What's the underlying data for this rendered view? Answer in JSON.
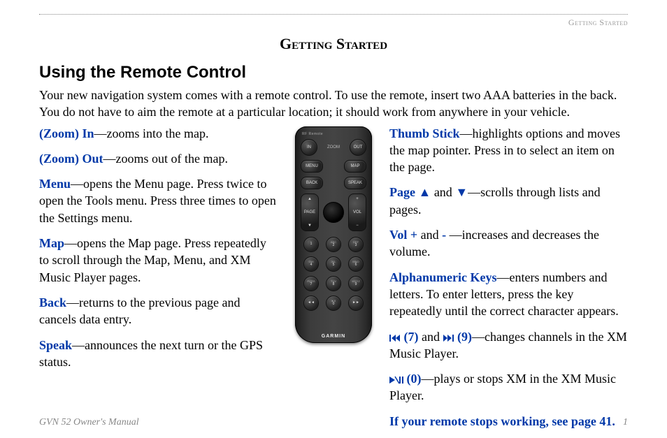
{
  "header": {
    "breadcrumb": "Getting Started"
  },
  "section_title": "Getting Started",
  "subheading": "Using the Remote Control",
  "intro": "Your new navigation system comes with a remote control. To use the remote, insert two AAA batteries in the back. You do not have to aim the remote at a particular location; it should work from anywhere in your vehicle.",
  "left": {
    "zoom_in": {
      "term": "(Zoom) In",
      "desc": "—zooms into the map."
    },
    "zoom_out": {
      "term": "(Zoom) Out",
      "desc": "—zooms out of the map."
    },
    "menu": {
      "term": "Menu",
      "desc": "—opens the Menu page. Press twice to open the Tools menu. Press three times to open the Settings menu."
    },
    "map": {
      "term": "Map",
      "desc": "—opens the Map page. Press repeatedly to scroll through the Map, Menu, and XM Music Player pages."
    },
    "back": {
      "term": "Back",
      "desc": "—returns to the previous page and cancels data entry."
    },
    "speak": {
      "term": "Speak",
      "desc": "—announces the next turn or the GPS status."
    }
  },
  "right": {
    "thumb": {
      "term": "Thumb Stick",
      "desc": "—highlights options and moves the map pointer. Press in to select an item on the page."
    },
    "page": {
      "term": "Page ",
      "mid": " and ",
      "desc": "—scrolls through lists and pages."
    },
    "vol": {
      "term": "Vol + ",
      "mid1": "and ",
      "minus": "-",
      "mid2": " —increases and decreases the volume."
    },
    "alpha": {
      "term": "Alphanumeric Keys",
      "desc": "—enters numbers and letters. To enter letters, press the key repeatedly until the correct character appears."
    },
    "seven_nine": {
      "t7": " (7)",
      "mid": " and ",
      "t9": " (9)",
      "desc": "—changes channels in the XM Music Player."
    },
    "zero": {
      "t0": " (0)",
      "desc": "—plays or stops XM in the XM Music Player."
    },
    "note": "If your remote stops working, see page 41."
  },
  "remote": {
    "top_label": "RF Remote",
    "in": "IN",
    "out": "OUT",
    "zoom": "ZOOM",
    "menu": "MENU",
    "map": "MAP",
    "back": "BACK",
    "speak": "SPEAK",
    "page": "PAGE",
    "vol": "VOL",
    "up": "▲",
    "down": "▼",
    "plus": "+",
    "minus": "−",
    "keys": [
      {
        "n": "1",
        "s": ""
      },
      {
        "n": "2",
        "s": "ABC"
      },
      {
        "n": "3",
        "s": "DEF"
      },
      {
        "n": "4",
        "s": "GHI"
      },
      {
        "n": "5",
        "s": "JKL"
      },
      {
        "n": "6",
        "s": "MNO"
      },
      {
        "n": "7",
        "s": "PQRS"
      },
      {
        "n": "8",
        "s": "TUV"
      },
      {
        "n": "9",
        "s": "WXYZ"
      },
      {
        "n": "◄◄",
        "s": ""
      },
      {
        "n": "0",
        "s": "►II"
      },
      {
        "n": "►►",
        "s": ""
      }
    ],
    "brand": "GARMIN"
  },
  "footer": {
    "left": "GVN 52 Owner's Manual",
    "right": "1"
  }
}
